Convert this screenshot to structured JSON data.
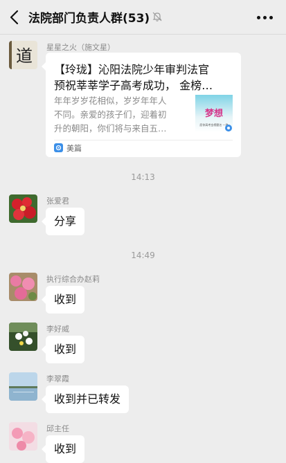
{
  "header": {
    "title": "法院部门负责人群(53)",
    "back_icon": "chevron-left-icon",
    "mute_icon": "bell-off-icon",
    "more_icon": "more-dots-icon"
  },
  "messages": [
    {
      "sender": "星星之火（施文星）",
      "card": {
        "title_line1": "【玲珑】沁阳法院少年审判法官",
        "title_line2": "预祝莘莘学子高考成功，  金榜…",
        "desc_line1": "年年岁岁花相似，岁岁年年人",
        "desc_line2": "不同。亲爱的孩子们，迎着初",
        "desc_line3": "升的朝阳，你们将与来自五…",
        "thumb_text": "梦想",
        "thumb_caption": "愿你高考金榜题名 一路",
        "source": "美篇"
      }
    },
    {
      "time": "14:13"
    },
    {
      "sender": "张爱君",
      "text": "分享"
    },
    {
      "time": "14:49"
    },
    {
      "sender": "执行综合办赵莉",
      "text": "收到"
    },
    {
      "sender": "李好威",
      "text": "收到"
    },
    {
      "sender": "李翠霞",
      "text": "收到并已转发"
    },
    {
      "sender": "邱主任",
      "text": "收到"
    }
  ]
}
